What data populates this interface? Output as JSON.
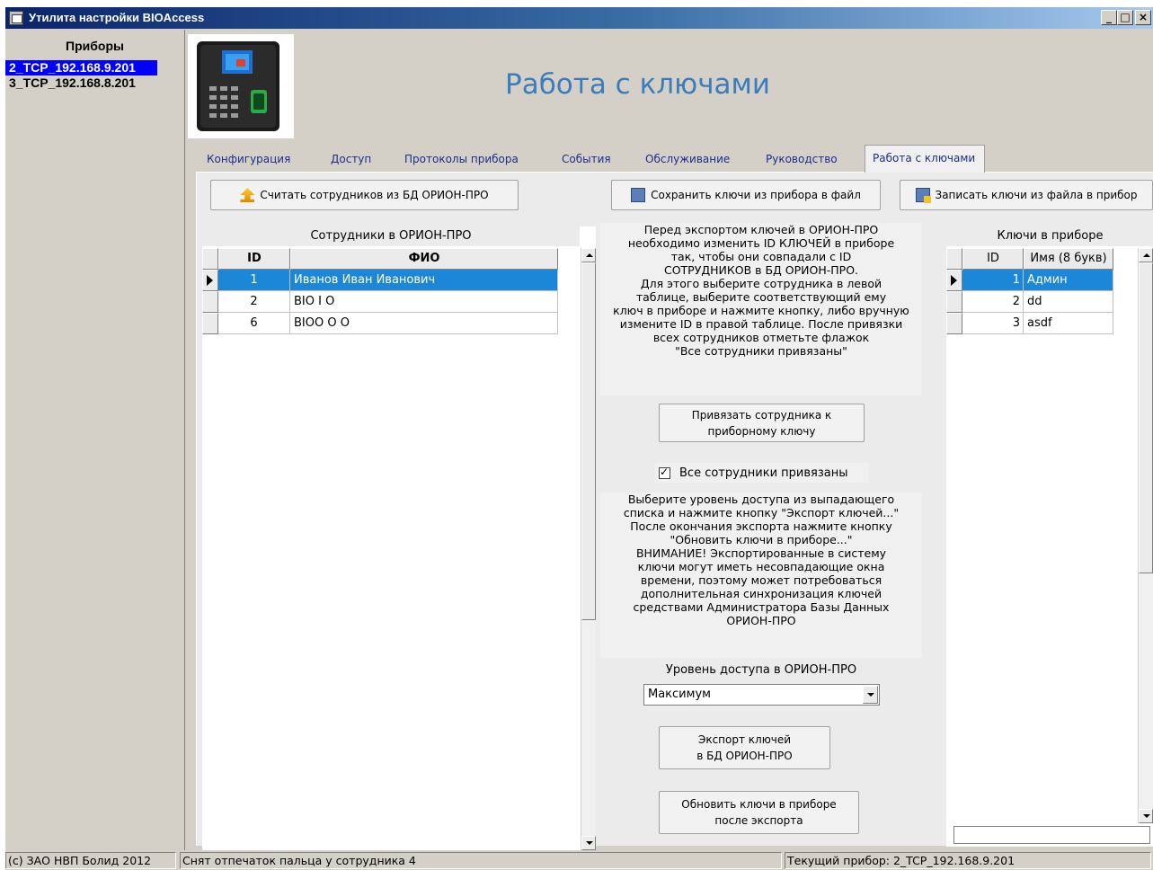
{
  "window": {
    "title": "Утилита настройки BIOAccess",
    "controls": [
      "_",
      "□",
      "×"
    ]
  },
  "devices": {
    "header": "Приборы",
    "items": [
      {
        "label": "2_TCP_192.168.9.201",
        "selected": true
      },
      {
        "label": "3_TCP_192.168.8.201",
        "selected": false
      }
    ]
  },
  "page_heading": "Работа с ключами",
  "tabs": [
    "Конфигурация",
    "Доступ",
    "Протоколы прибора",
    "События",
    "Обслуживание",
    "Руководство",
    "Работа с ключами"
  ],
  "active_tab": "Работа с ключами",
  "toolbar": {
    "read_employees": "Считать сотрудников из БД ОРИОН-ПРО",
    "save_keys": "Сохранить ключи из прибора в файл",
    "write_keys": "Записать ключи из файла в прибор"
  },
  "employees": {
    "caption": "Сотрудники в ОРИОН-ПРО",
    "columns": [
      "ID",
      "ФИО"
    ],
    "rows": [
      {
        "id": "1",
        "name": "Иванов Иван Иванович",
        "selected": true
      },
      {
        "id": "2",
        "name": "BIO I O",
        "selected": false
      },
      {
        "id": "6",
        "name": "BIOO O O",
        "selected": false
      }
    ]
  },
  "instructions_top": [
    "Перед экспортом ключей в ОРИОН-ПРО",
    "необходимо изменить ID КЛЮЧЕЙ в приборе",
    "так, чтобы они совпадали с ID",
    "СОТРУДНИКОВ в БД ОРИОН-ПРО.",
    "Для этого выберите сотрудника в левой",
    "таблице, выберите соответствующий ему",
    "ключ в приборе и нажмите кнопку, либо вручную",
    "измените ID в правой таблице. После привязки",
    "всех  сотрудников отметьте  флажок",
    "\"Все сотрудники привязаны\""
  ],
  "bind_button": [
    "Привязать сотрудника к",
    "приборному ключу"
  ],
  "all_bound": {
    "label": "Все сотрудники привязаны",
    "checked": true
  },
  "instructions_bottom": [
    "Выберите уровень доступа из выпадающего",
    "списка и нажмите кнопку \"Экспорт ключей...\"",
    "После окончания экспорта нажмите кнопку",
    "\"Обновить ключи в приборе...\"",
    "ВНИМАНИЕ!  Экспортированные в систему",
    "ключи могут иметь несовпадающие окна",
    "времени, поэтому может потребоваться",
    "дополнительная синхронизация ключей",
    "средствами Администратора Базы Данных",
    "ОРИОН-ПРО"
  ],
  "access_level": {
    "label": "Уровень доступа в ОРИОН-ПРО",
    "value": "Максимум"
  },
  "export_button": [
    "Экспорт ключей",
    "в БД ОРИОН-ПРО"
  ],
  "refresh_button": [
    "Обновить ключи в приборе",
    "после экспорта"
  ],
  "keys": {
    "caption": "Ключи в приборе",
    "columns": [
      "ID",
      "Имя (8 букв)"
    ],
    "rows": [
      {
        "id": "1",
        "name": "Админ",
        "selected": true
      },
      {
        "id": "2",
        "name": "dd",
        "selected": false
      },
      {
        "id": "3",
        "name": "asdf",
        "selected": false
      }
    ],
    "edit_value": ""
  },
  "statusbar": {
    "copyright": "(с) ЗАО НВП Болид 2012",
    "message": "Снят отпечаток пальца у сотрудника 4",
    "current_device": "Текущий прибор: 2_TCP_192.168.9.201"
  },
  "colors": {
    "selection": "#1c87d6",
    "heading": "#3c7cbb",
    "tab_text": "#1a2e8c",
    "device_selected": "#0000ff"
  }
}
